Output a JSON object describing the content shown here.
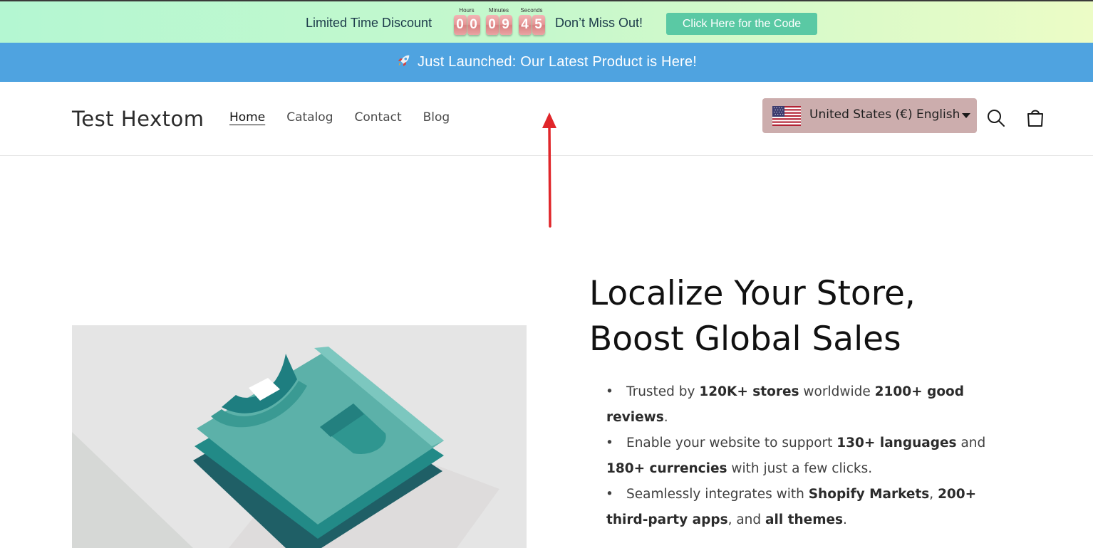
{
  "countdown": {
    "left_text": "Limited Time Discount",
    "right_text": "Don’t Miss Out!",
    "hours_label": "Hours",
    "minutes_label": "Minutes",
    "seconds_label": "Seconds",
    "hours": [
      "0",
      "0"
    ],
    "minutes": [
      "0",
      "9"
    ],
    "seconds": [
      "4",
      "5"
    ],
    "button_label": "Click Here for the Code",
    "button_color": "#5ac9a4",
    "digit_color": "#e59595"
  },
  "announcement": {
    "icon": "rocket-icon",
    "text": "Just Launched: Our Latest Product is Here!",
    "background": "#4fa3e0"
  },
  "header": {
    "logo": "Test Hextom",
    "nav": [
      "Home",
      "Catalog",
      "Contact",
      "Blog"
    ],
    "active_nav": "Home",
    "locale_selector": {
      "flag": "us-flag-icon",
      "label": "United States (€) English",
      "background": "#ccadad"
    },
    "icons": [
      "search-icon",
      "cart-icon"
    ]
  },
  "hero": {
    "heading_line1": "Localize Your Store,",
    "heading_line2": "Boost Global Sales",
    "bullets": [
      {
        "parts": [
          {
            "t": "Trusted by ",
            "b": false
          },
          {
            "t": "120K+ stores",
            "b": true
          },
          {
            "t": " worldwide ",
            "b": false
          },
          {
            "t": "2100+ good reviews",
            "b": true
          },
          {
            "t": ".",
            "b": false
          }
        ]
      },
      {
        "parts": [
          {
            "t": "Enable your website to support ",
            "b": false
          },
          {
            "t": "130+ languages",
            "b": true
          },
          {
            "t": " and ",
            "b": false
          },
          {
            "t": "180+ currencies",
            "b": true
          },
          {
            "t": " with just a few clicks.",
            "b": false
          }
        ]
      },
      {
        "parts": [
          {
            "t": "Seamlessly integrates with ",
            "b": false
          },
          {
            "t": "Shopify Markets",
            "b": true
          },
          {
            "t": ", ",
            "b": false
          },
          {
            "t": "200+ third-party apps",
            "b": true
          },
          {
            "t": ", and ",
            "b": false
          },
          {
            "t": "all themes",
            "b": true
          },
          {
            "t": ".",
            "b": false
          }
        ]
      }
    ],
    "image": "folded-shirts-illustration"
  },
  "annotation": {
    "type": "red-arrow-up",
    "color": "#e0262a"
  }
}
